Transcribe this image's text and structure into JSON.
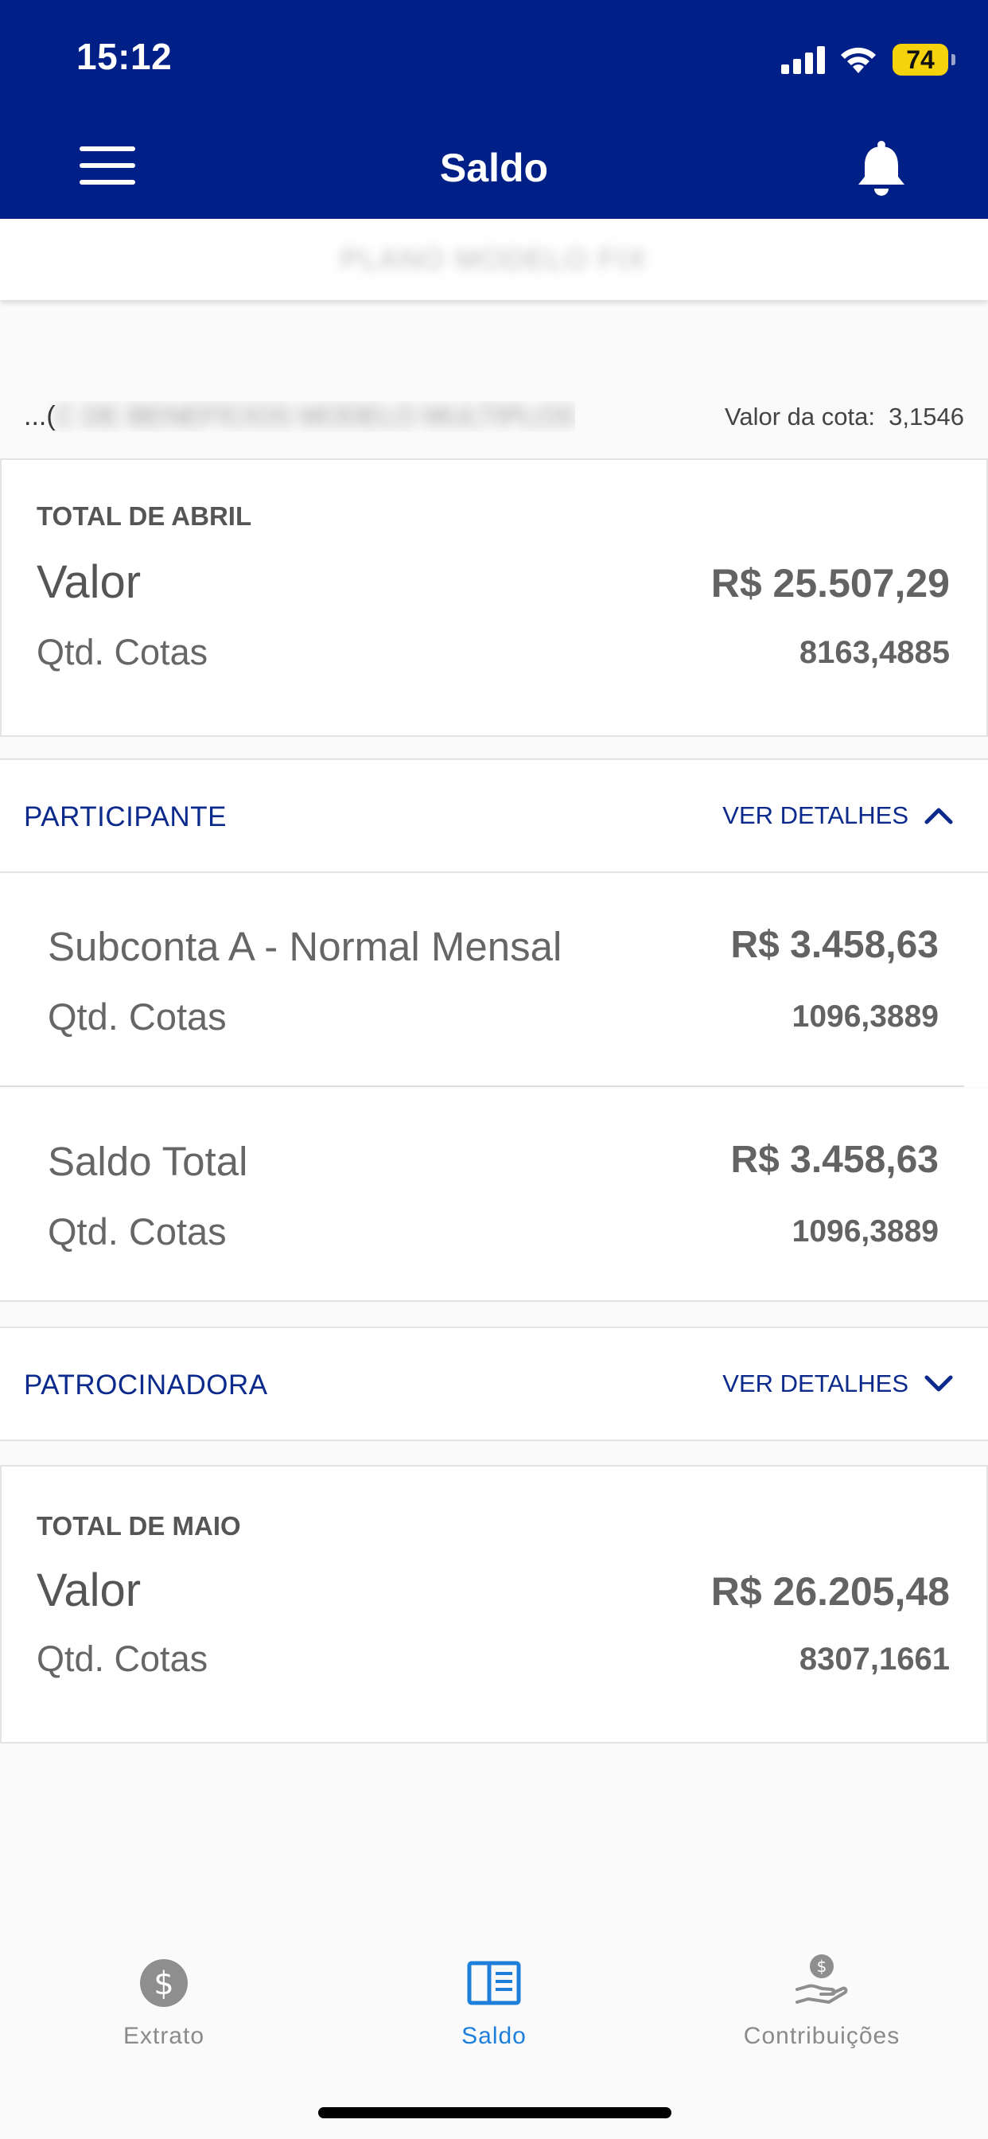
{
  "status_bar": {
    "time": "15:12",
    "battery": "74"
  },
  "header": {
    "title": "Saldo"
  },
  "plan": {
    "name": "PLANO MODELO FIX"
  },
  "fund": {
    "prefix": "...(",
    "name_hidden": "C DE BENEFÍCIOS MODELO MULTIPLOS",
    "quota_label": "Valor da cota:",
    "quota_value": "3,1546"
  },
  "total_abril": {
    "title": "TOTAL DE ABRIL",
    "valor_label": "Valor",
    "valor": "R$ 25.507,29",
    "cotas_label": "Qtd. Cotas",
    "cotas": "8163,4885"
  },
  "participante": {
    "label": "PARTICIPANTE",
    "link": "VER DETALHES",
    "subconta": {
      "label": "Subconta A - Normal Mensal",
      "valor": "R$ 3.458,63",
      "cotas_label": "Qtd. Cotas",
      "cotas": "1096,3889"
    },
    "saldo_total": {
      "label": "Saldo Total",
      "valor": "R$ 3.458,63",
      "cotas_label": "Qtd. Cotas",
      "cotas": "1096,3889"
    }
  },
  "patrocinadora": {
    "label": "PATROCINADORA",
    "link": "VER DETALHES"
  },
  "total_maio": {
    "title": "TOTAL DE MAIO",
    "valor_label": "Valor",
    "valor": "R$ 26.205,48",
    "cotas_label": "Qtd. Cotas",
    "cotas": "8307,1661"
  },
  "tabs": [
    {
      "label": "Extrato",
      "icon": "dollar-circle-icon"
    },
    {
      "label": "Saldo",
      "icon": "statement-book-icon",
      "active": true
    },
    {
      "label": "Contribuições",
      "icon": "hand-coin-icon"
    }
  ],
  "colors": {
    "header_bg": "#001f87",
    "accent": "#1e7fdb",
    "section_text": "#0b2a8c"
  }
}
